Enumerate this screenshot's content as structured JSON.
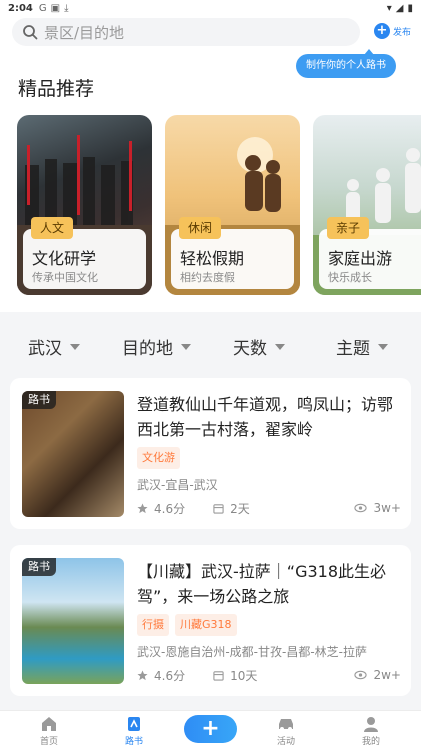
{
  "statusbar": {
    "time": "2:04"
  },
  "search": {
    "placeholder": "景区/目的地"
  },
  "publish": {
    "label": "发布"
  },
  "tooltip": {
    "text": "制作你的个人路书"
  },
  "featured": {
    "title": "精品推荐",
    "cards": [
      {
        "tag": "人文",
        "title": "文化研学",
        "subtitle": "传承中国文化"
      },
      {
        "tag": "休闲",
        "title": "轻松假期",
        "subtitle": "相约去度假"
      },
      {
        "tag": "亲子",
        "title": "家庭出游",
        "subtitle": "快乐成长"
      }
    ]
  },
  "filters": [
    "武汉",
    "目的地",
    "天数",
    "主题"
  ],
  "routes": [
    {
      "badge": "路书",
      "title": "登道教仙山千年道观，鸣凤山；访鄂西北第一古村落，翟家岭",
      "tags": [
        "文化游"
      ],
      "route": "武汉-宜昌-武汉",
      "rating": "4.6分",
      "days": "2天",
      "views": "3w+"
    },
    {
      "badge": "路书",
      "title": "【川藏】武汉-拉萨｜“G318此生必驾”，来一场公路之旅",
      "tags": [
        "行摄",
        "川藏G318"
      ],
      "route": "武汉-恩施自治州-成都-甘孜-昌都-林芝-拉萨",
      "rating": "4.6分",
      "days": "10天",
      "views": "2w+"
    }
  ],
  "tabbar": {
    "home": "首页",
    "roadbook": "路书",
    "add": "+",
    "activity": "活动",
    "mine": "我的"
  },
  "colors": {
    "accent": "#2a86f0",
    "tag_bg": "#fdeee6",
    "tag_fg": "#ff7a3c",
    "card_tag": "#f6c25a"
  }
}
